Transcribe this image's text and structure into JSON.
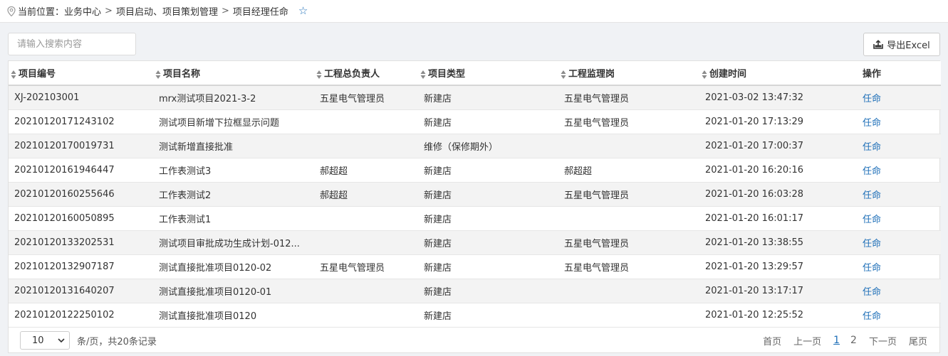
{
  "breadcrumb": {
    "prefix": "当前位置：",
    "items": [
      "业务中心",
      "项目启动、项目策划管理",
      "项目经理任命"
    ],
    "separator": ">"
  },
  "search": {
    "placeholder": "请输入搜索内容",
    "value": ""
  },
  "toolbar": {
    "export_label": "导出Excel"
  },
  "table": {
    "columns": [
      "项目编号",
      "项目名称",
      "工程总负责人",
      "项目类型",
      "工程监理岗",
      "创建时间",
      "操作"
    ],
    "rows": [
      [
        "XJ-202103001",
        "mrx测试项目2021-3-2",
        "五星电气管理员",
        "新建店",
        "五星电气管理员",
        "2021-03-02 13:47:32",
        "任命"
      ],
      [
        "20210120171243102",
        "测试项目新增下拉框显示问题",
        "",
        "新建店",
        "五星电气管理员",
        "2021-01-20 17:13:29",
        "任命"
      ],
      [
        "20210120170019731",
        "测试新增直接批准",
        "",
        "维修（保修期外）",
        "",
        "2021-01-20 17:00:37",
        "任命"
      ],
      [
        "20210120161946447",
        "工作表测试3",
        "郝超超",
        "新建店",
        "郝超超",
        "2021-01-20 16:20:16",
        "任命"
      ],
      [
        "20210120160255646",
        "工作表测试2",
        "郝超超",
        "新建店",
        "五星电气管理员",
        "2021-01-20 16:03:28",
        "任命"
      ],
      [
        "20210120160050895",
        "工作表测试1",
        "",
        "新建店",
        "",
        "2021-01-20 16:01:17",
        "任命"
      ],
      [
        "20210120133202531",
        "测试项目审批成功生成计划-012...",
        "",
        "新建店",
        "五星电气管理员",
        "2021-01-20 13:38:55",
        "任命"
      ],
      [
        "20210120132907187",
        "测试直接批准项目0120-02",
        "五星电气管理员",
        "新建店",
        "五星电气管理员",
        "2021-01-20 13:29:57",
        "任命"
      ],
      [
        "20210120131640207",
        "测试直接批准项目0120-01",
        "",
        "新建店",
        "",
        "2021-01-20 13:17:17",
        "任命"
      ],
      [
        "20210120122250102",
        "测试直接批准项目0120",
        "",
        "新建店",
        "",
        "2021-01-20 12:25:52",
        "任命"
      ]
    ]
  },
  "pager": {
    "page_size": "10",
    "size_info": "条/页，共20条记录",
    "first": "首页",
    "prev": "上一页",
    "pages": [
      "1",
      "2"
    ],
    "current_page": "1",
    "next": "下一页",
    "last": "尾页"
  },
  "colors": {
    "accent": "#1e6fb8",
    "stripe": "#f3f3f3",
    "background": "#f0f2f5"
  }
}
